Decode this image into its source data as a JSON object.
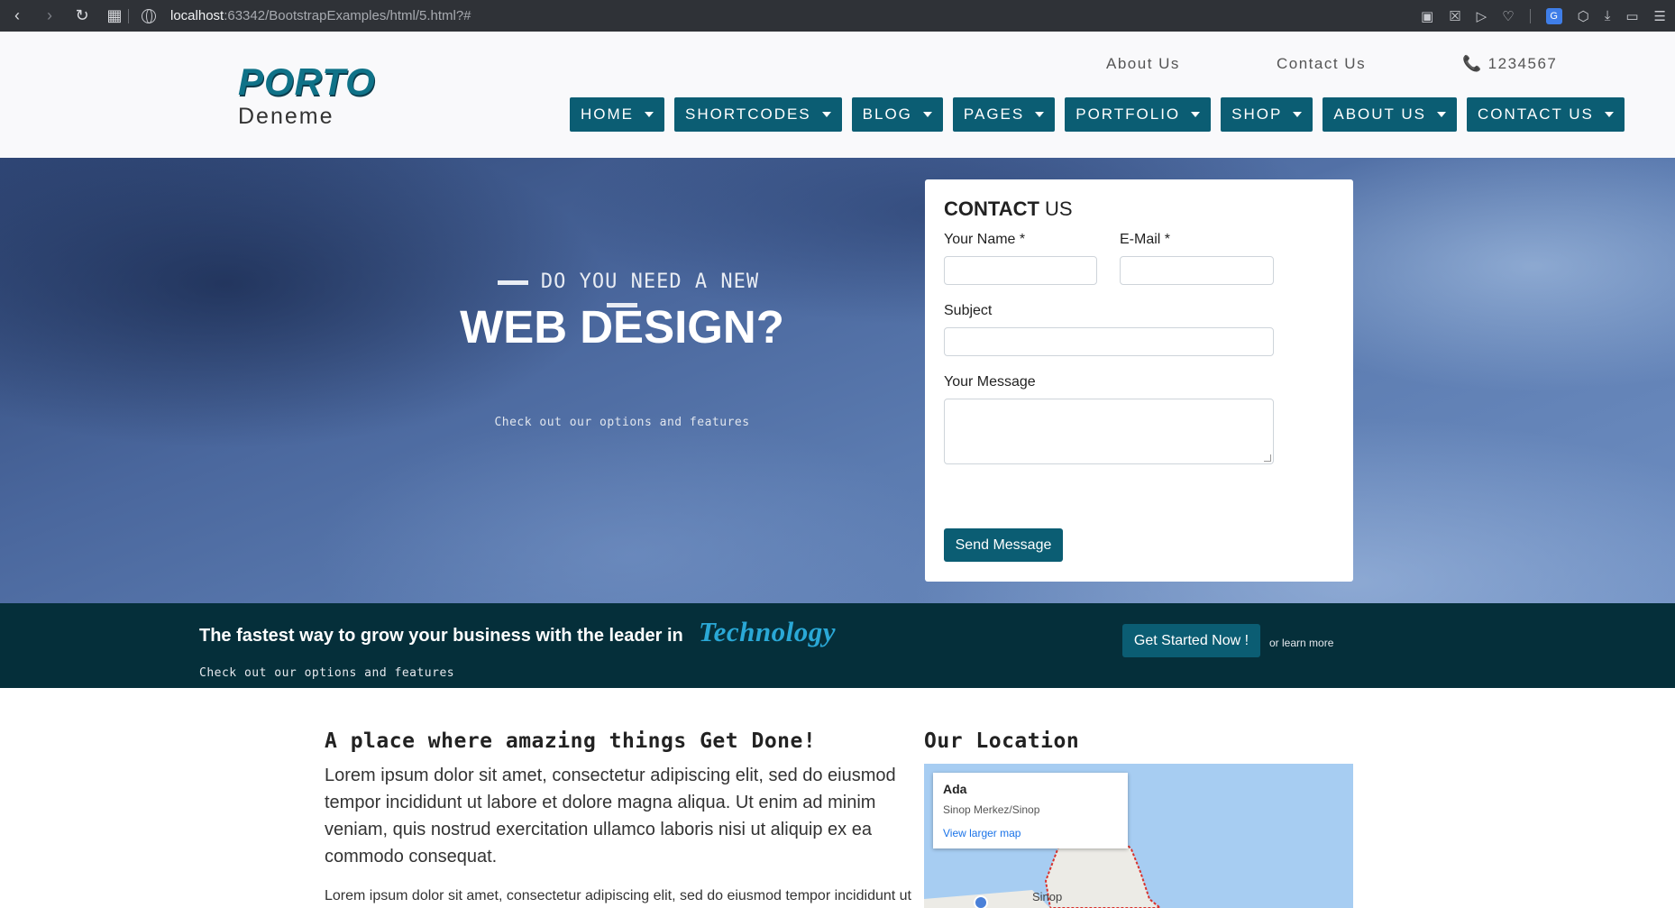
{
  "browser": {
    "url_host": "localhost",
    "url_path": ":63342/BootstrapExamples/html/5.html?#",
    "translate_label": "G"
  },
  "header": {
    "logo_title": "PORTO",
    "logo_subtitle": "Deneme",
    "top_links": {
      "about": "About Us",
      "contact": "Contact Us",
      "phone": "1234567"
    },
    "menu": [
      {
        "label": "HOME"
      },
      {
        "label": "SHORTCODES"
      },
      {
        "label": "BLOG"
      },
      {
        "label": "PAGES"
      },
      {
        "label": "PORTFOLIO"
      },
      {
        "label": "SHOP"
      },
      {
        "label": "ABOUT US"
      },
      {
        "label": "CONTACT US"
      }
    ]
  },
  "hero": {
    "pretitle": "DO YOU NEED A NEW",
    "title": "WEB DESIGN?",
    "subtitle": "Check out our options and features"
  },
  "contact_form": {
    "title_bold": "CONTACT",
    "title_rest": " US",
    "name_label": "Your Name *",
    "email_label": "E-Mail *",
    "subject_label": "Subject",
    "message_label": "Your Message",
    "name_value": "",
    "email_value": "",
    "subject_value": "",
    "message_value": "",
    "send_label": "Send Message"
  },
  "cta": {
    "headline": "The fastest way to grow your business with the leader in",
    "highlight": "Technology",
    "sub": "Check out our options and features",
    "button": "Get Started Now !",
    "learn_more": "or learn more"
  },
  "content": {
    "title_pre": "A place where amazing things ",
    "title_bold": "Get Done!",
    "paragraph": "Lorem ipsum dolor sit amet, consectetur adipiscing elit, sed do eiusmod tempor incididunt ut labore et dolore magna aliqua. Ut enim ad minim veniam, quis nostrud exercitation ullamco laboris nisi ut aliquip ex ea commodo consequat.",
    "paragraph2": "Lorem ipsum dolor sit amet, consectetur adipiscing elit, sed do eiusmod tempor incididunt ut",
    "location_pre": "Our ",
    "location_bold": "Location",
    "map_card": {
      "title": "Ada",
      "subtitle": "Sinop Merkez/Sinop",
      "link": "View larger map"
    },
    "map_label": "Sinop"
  },
  "colors": {
    "brand": "#0b5d73",
    "cta_bg": "#052f3a",
    "highlight": "#2aa8d6"
  }
}
